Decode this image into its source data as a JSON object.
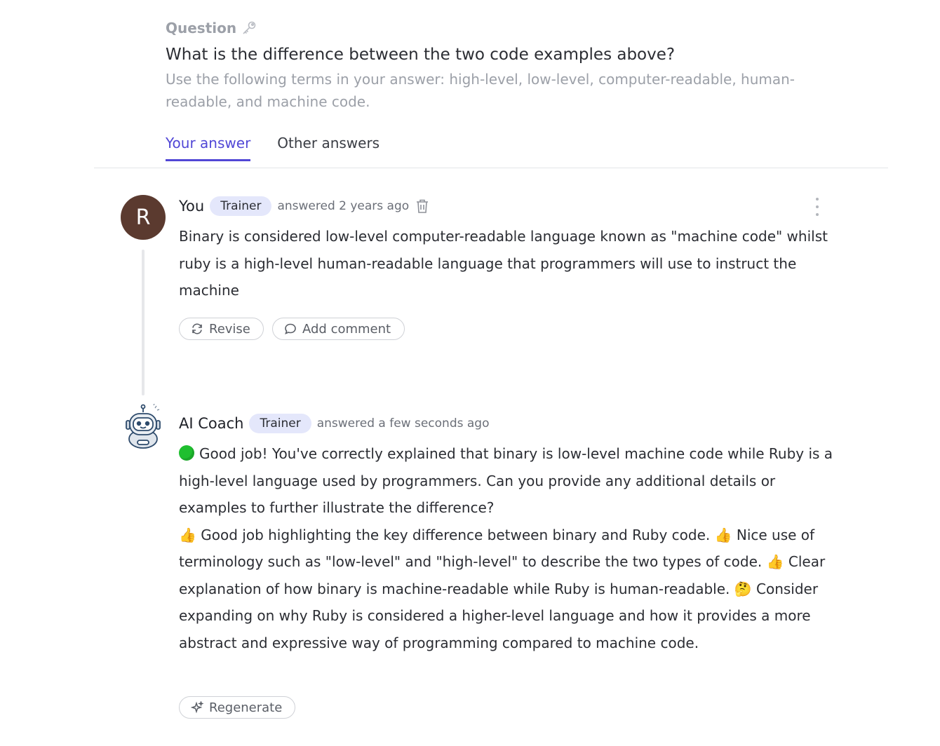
{
  "question": {
    "header": "Question",
    "header_icon": "key-icon",
    "title": "What is the difference between the two code examples above?",
    "hint": "Use the following terms in your answer: high-level, low-level, computer-readable, human-readable, and machine code."
  },
  "tabs": [
    {
      "label": "Your answer",
      "active": true
    },
    {
      "label": "Other answers",
      "active": false
    }
  ],
  "user_answer": {
    "avatar_letter": "R",
    "avatar_color": "#5b3a2f",
    "author": "You",
    "badge": "Trainer",
    "timestamp": "answered 2 years ago",
    "text": "Binary is considered low-level computer-readable language known as \"machine code\" whilst ruby is a high-level human-readable language that programmers will use to instruct the machine",
    "actions": {
      "revise": "Revise",
      "add_comment": "Add comment"
    }
  },
  "ai_answer": {
    "author": "AI Coach",
    "badge": "Trainer",
    "timestamp": "answered a few seconds ago",
    "paragraph1": "Good job! You've correctly explained that binary is low-level machine code while Ruby is a high-level language used by programmers. Can you provide any additional details or examples to further illustrate the difference?",
    "feedback1": "Good job highlighting the key difference between binary and Ruby code.",
    "feedback2": "Nice use of terminology such as \"low-level\" and \"high-level\" to describe the two types of code.",
    "feedback3": "Clear explanation of how binary is machine-readable while Ruby is human-readable.",
    "feedback4": "Consider expanding on why Ruby is considered a higher-level language and how it provides a more abstract and expressive way of programming compared to machine code.",
    "emoji_thumbs": "👍",
    "emoji_thinking": "🤔",
    "regenerate": "Regenerate"
  },
  "colors": {
    "accent": "#5147d6",
    "badge_bg": "#e4e7fb",
    "muted": "#9ca0a8"
  }
}
